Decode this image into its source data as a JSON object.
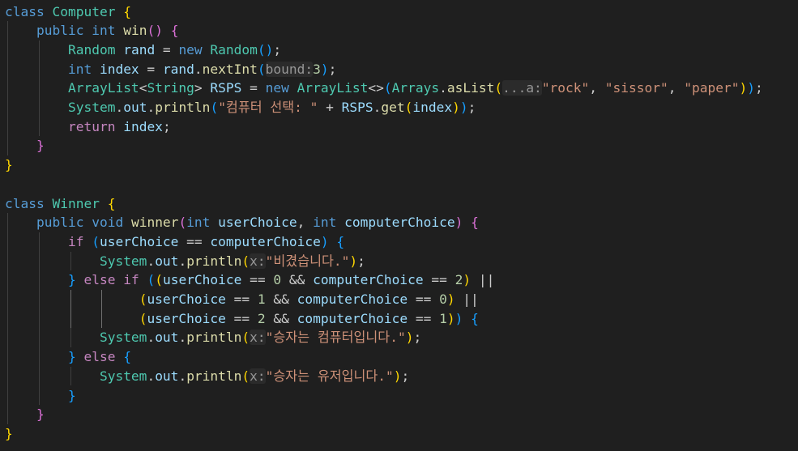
{
  "editor": {
    "lines": [
      [
        [
          "class ",
          "kw"
        ],
        [
          "Computer",
          "ty"
        ],
        [
          " ",
          "pl"
        ],
        [
          "{",
          "b1"
        ]
      ],
      [
        [
          "    ",
          "pl"
        ],
        [
          "public ",
          "kw"
        ],
        [
          "int ",
          "kw"
        ],
        [
          "win",
          "fn"
        ],
        [
          "()",
          "b2"
        ],
        [
          " ",
          "pl"
        ],
        [
          "{",
          "b2"
        ]
      ],
      [
        [
          "        ",
          "pl"
        ],
        [
          "Random ",
          "ty"
        ],
        [
          "rand",
          "var"
        ],
        [
          " = ",
          "pl"
        ],
        [
          "new ",
          "kw"
        ],
        [
          "Random",
          "ty"
        ],
        [
          "()",
          "b3"
        ],
        [
          ";",
          "pl"
        ]
      ],
      [
        [
          "        ",
          "pl"
        ],
        [
          "int ",
          "kw"
        ],
        [
          "index",
          "var"
        ],
        [
          " = ",
          "pl"
        ],
        [
          "rand",
          "var"
        ],
        [
          ".",
          "pl"
        ],
        [
          "nextInt",
          "fn"
        ],
        [
          "(",
          "b3"
        ],
        [
          "bound:",
          "hint"
        ],
        [
          "3",
          "num"
        ],
        [
          ")",
          "b3"
        ],
        [
          ";",
          "pl"
        ]
      ],
      [
        [
          "        ",
          "pl"
        ],
        [
          "ArrayList",
          "ty"
        ],
        [
          "<",
          "pl"
        ],
        [
          "String",
          "ty"
        ],
        [
          "> ",
          "pl"
        ],
        [
          "RSPS",
          "var"
        ],
        [
          " = ",
          "pl"
        ],
        [
          "new ",
          "kw"
        ],
        [
          "ArrayList",
          "ty"
        ],
        [
          "<>",
          "pl"
        ],
        [
          "(",
          "b3"
        ],
        [
          "Arrays",
          "ty"
        ],
        [
          ".",
          "pl"
        ],
        [
          "asList",
          "fn"
        ],
        [
          "(",
          "b1"
        ],
        [
          "...a:",
          "hint"
        ],
        [
          "\"rock\"",
          "str"
        ],
        [
          ", ",
          "pl"
        ],
        [
          "\"sissor\"",
          "str"
        ],
        [
          ", ",
          "pl"
        ],
        [
          "\"paper\"",
          "str"
        ],
        [
          ")",
          "b1"
        ],
        [
          ")",
          "b3"
        ],
        [
          ";",
          "pl"
        ]
      ],
      [
        [
          "        ",
          "pl"
        ],
        [
          "System",
          "ty"
        ],
        [
          ".",
          "pl"
        ],
        [
          "out",
          "var"
        ],
        [
          ".",
          "pl"
        ],
        [
          "println",
          "fn"
        ],
        [
          "(",
          "b3"
        ],
        [
          "\"컴퓨터 선택: \"",
          "str"
        ],
        [
          " + ",
          "pl"
        ],
        [
          "RSPS",
          "var"
        ],
        [
          ".",
          "pl"
        ],
        [
          "get",
          "fn"
        ],
        [
          "(",
          "b1"
        ],
        [
          "index",
          "var"
        ],
        [
          ")",
          "b1"
        ],
        [
          ")",
          "b3"
        ],
        [
          ";",
          "pl"
        ]
      ],
      [
        [
          "        ",
          "pl"
        ],
        [
          "return ",
          "ctl"
        ],
        [
          "index",
          "var"
        ],
        [
          ";",
          "pl"
        ]
      ],
      [
        [
          "    ",
          "pl"
        ],
        [
          "}",
          "b2"
        ]
      ],
      [
        [
          "}",
          "b1"
        ]
      ],
      [],
      [
        [
          "class ",
          "kw"
        ],
        [
          "Winner",
          "ty"
        ],
        [
          " ",
          "pl"
        ],
        [
          "{",
          "b1"
        ]
      ],
      [
        [
          "    ",
          "pl"
        ],
        [
          "public ",
          "kw"
        ],
        [
          "void ",
          "kw"
        ],
        [
          "winner",
          "fn"
        ],
        [
          "(",
          "b2"
        ],
        [
          "int ",
          "kw"
        ],
        [
          "userChoice",
          "var"
        ],
        [
          ", ",
          "pl"
        ],
        [
          "int ",
          "kw"
        ],
        [
          "computerChoice",
          "var"
        ],
        [
          ")",
          "b2"
        ],
        [
          " ",
          "pl"
        ],
        [
          "{",
          "b2"
        ]
      ],
      [
        [
          "        ",
          "pl"
        ],
        [
          "if ",
          "ctl"
        ],
        [
          "(",
          "b3"
        ],
        [
          "userChoice",
          "var"
        ],
        [
          " == ",
          "pl"
        ],
        [
          "computerChoice",
          "var"
        ],
        [
          ")",
          "b3"
        ],
        [
          " ",
          "pl"
        ],
        [
          "{",
          "b3"
        ]
      ],
      [
        [
          "            ",
          "pl"
        ],
        [
          "System",
          "ty"
        ],
        [
          ".",
          "pl"
        ],
        [
          "out",
          "var"
        ],
        [
          ".",
          "pl"
        ],
        [
          "println",
          "fn"
        ],
        [
          "(",
          "b1"
        ],
        [
          "x:",
          "hint"
        ],
        [
          "\"비겼습니다.\"",
          "str"
        ],
        [
          ")",
          "b1"
        ],
        [
          ";",
          "pl"
        ]
      ],
      [
        [
          "        ",
          "pl"
        ],
        [
          "}",
          "b3"
        ],
        [
          " ",
          "pl"
        ],
        [
          "else ",
          "ctl"
        ],
        [
          "if ",
          "ctl"
        ],
        [
          "(",
          "b3"
        ],
        [
          "(",
          "b1"
        ],
        [
          "userChoice",
          "var"
        ],
        [
          " == ",
          "pl"
        ],
        [
          "0",
          "num"
        ],
        [
          " && ",
          "pl"
        ],
        [
          "computerChoice",
          "var"
        ],
        [
          " == ",
          "pl"
        ],
        [
          "2",
          "num"
        ],
        [
          ")",
          "b1"
        ],
        [
          " ||",
          "pl"
        ]
      ],
      [
        [
          "                 ",
          "pl"
        ],
        [
          "(",
          "b1"
        ],
        [
          "userChoice",
          "var"
        ],
        [
          " == ",
          "pl"
        ],
        [
          "1",
          "num"
        ],
        [
          " && ",
          "pl"
        ],
        [
          "computerChoice",
          "var"
        ],
        [
          " == ",
          "pl"
        ],
        [
          "0",
          "num"
        ],
        [
          ")",
          "b1"
        ],
        [
          " ||",
          "pl"
        ]
      ],
      [
        [
          "                 ",
          "pl"
        ],
        [
          "(",
          "b1"
        ],
        [
          "userChoice",
          "var"
        ],
        [
          " == ",
          "pl"
        ],
        [
          "2",
          "num"
        ],
        [
          " && ",
          "pl"
        ],
        [
          "computerChoice",
          "var"
        ],
        [
          " == ",
          "pl"
        ],
        [
          "1",
          "num"
        ],
        [
          ")",
          "b1"
        ],
        [
          ")",
          "b3"
        ],
        [
          " ",
          "pl"
        ],
        [
          "{",
          "b3"
        ]
      ],
      [
        [
          "            ",
          "pl"
        ],
        [
          "System",
          "ty"
        ],
        [
          ".",
          "pl"
        ],
        [
          "out",
          "var"
        ],
        [
          ".",
          "pl"
        ],
        [
          "println",
          "fn"
        ],
        [
          "(",
          "b1"
        ],
        [
          "x:",
          "hint"
        ],
        [
          "\"승자는 컴퓨터입니다.\"",
          "str"
        ],
        [
          ")",
          "b1"
        ],
        [
          ";",
          "pl"
        ]
      ],
      [
        [
          "        ",
          "pl"
        ],
        [
          "}",
          "b3"
        ],
        [
          " ",
          "pl"
        ],
        [
          "else ",
          "ctl"
        ],
        [
          "{",
          "b3"
        ]
      ],
      [
        [
          "            ",
          "pl"
        ],
        [
          "System",
          "ty"
        ],
        [
          ".",
          "pl"
        ],
        [
          "out",
          "var"
        ],
        [
          ".",
          "pl"
        ],
        [
          "println",
          "fn"
        ],
        [
          "(",
          "b1"
        ],
        [
          "x:",
          "hint"
        ],
        [
          "\"승자는 유저입니다.\"",
          "str"
        ],
        [
          ")",
          "b1"
        ],
        [
          ";",
          "pl"
        ]
      ],
      [
        [
          "        ",
          "pl"
        ],
        [
          "}",
          "b3"
        ]
      ],
      [
        [
          "    ",
          "pl"
        ],
        [
          "}",
          "b2"
        ]
      ],
      [
        [
          "}",
          "b1"
        ]
      ]
    ]
  }
}
